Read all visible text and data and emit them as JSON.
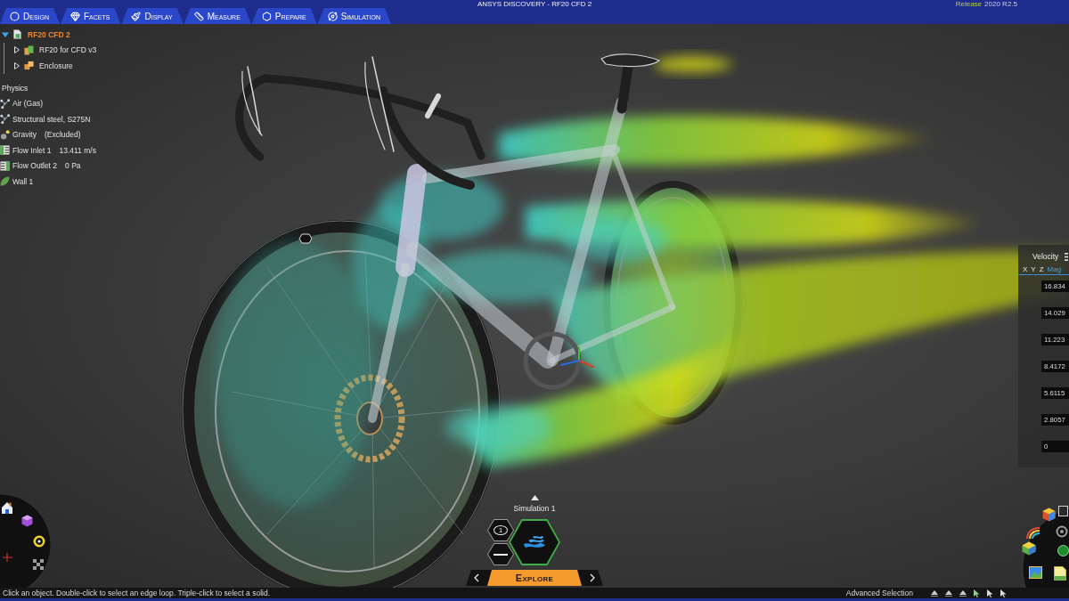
{
  "window": {
    "title": "ANSYS DISCOVERY - RF20 CFD 2",
    "release_label": "Release",
    "release_version": "2020 R2.5"
  },
  "tabs": [
    {
      "label": "Design",
      "selected": false
    },
    {
      "label": "Facets",
      "selected": false
    },
    {
      "label": "Display",
      "selected": false
    },
    {
      "label": "Measure",
      "selected": false
    },
    {
      "label": "Prepare",
      "selected": false
    },
    {
      "label": "Simulation",
      "selected": false
    }
  ],
  "tree": [
    {
      "label": "RF20 CFD 2",
      "kind": "document",
      "expanded": true,
      "children": [
        {
          "label": "RF20 for CFD v3",
          "kind": "part",
          "expanded": false
        },
        {
          "label": "Enclosure",
          "kind": "enclosure",
          "expanded": false
        }
      ]
    }
  ],
  "physics": {
    "title": "Physics",
    "items": [
      {
        "kind": "material",
        "name": "Air (Gas)"
      },
      {
        "kind": "material",
        "name": "Structural steel, S275N"
      },
      {
        "kind": "gravity",
        "name": "Gravity",
        "value": "(Excluded)"
      },
      {
        "kind": "inlet",
        "name": "Flow Inlet 1",
        "value": "13.411 m/s"
      },
      {
        "kind": "outlet",
        "name": "Flow Outlet 2",
        "value": "0 Pa"
      },
      {
        "kind": "wall",
        "name": "Wall 1"
      }
    ]
  },
  "legend": {
    "title": "Velocity",
    "tabs": [
      {
        "label": "X",
        "selected": false
      },
      {
        "label": "Y",
        "selected": false
      },
      {
        "label": "Z",
        "selected": false
      },
      {
        "label": "Mag",
        "selected": true
      }
    ],
    "values": [
      "16.834",
      "14.029",
      "11.223",
      "8.4172",
      "5.6115",
      "2.8057",
      "0"
    ]
  },
  "simulation": {
    "name": "Simulation 1",
    "badge": "1",
    "mode": "Explore"
  },
  "status_bar": {
    "hint": "Click an object. Double-click to select an edge loop. Triple-click to select a solid.",
    "mode": "Advanced Selection"
  }
}
